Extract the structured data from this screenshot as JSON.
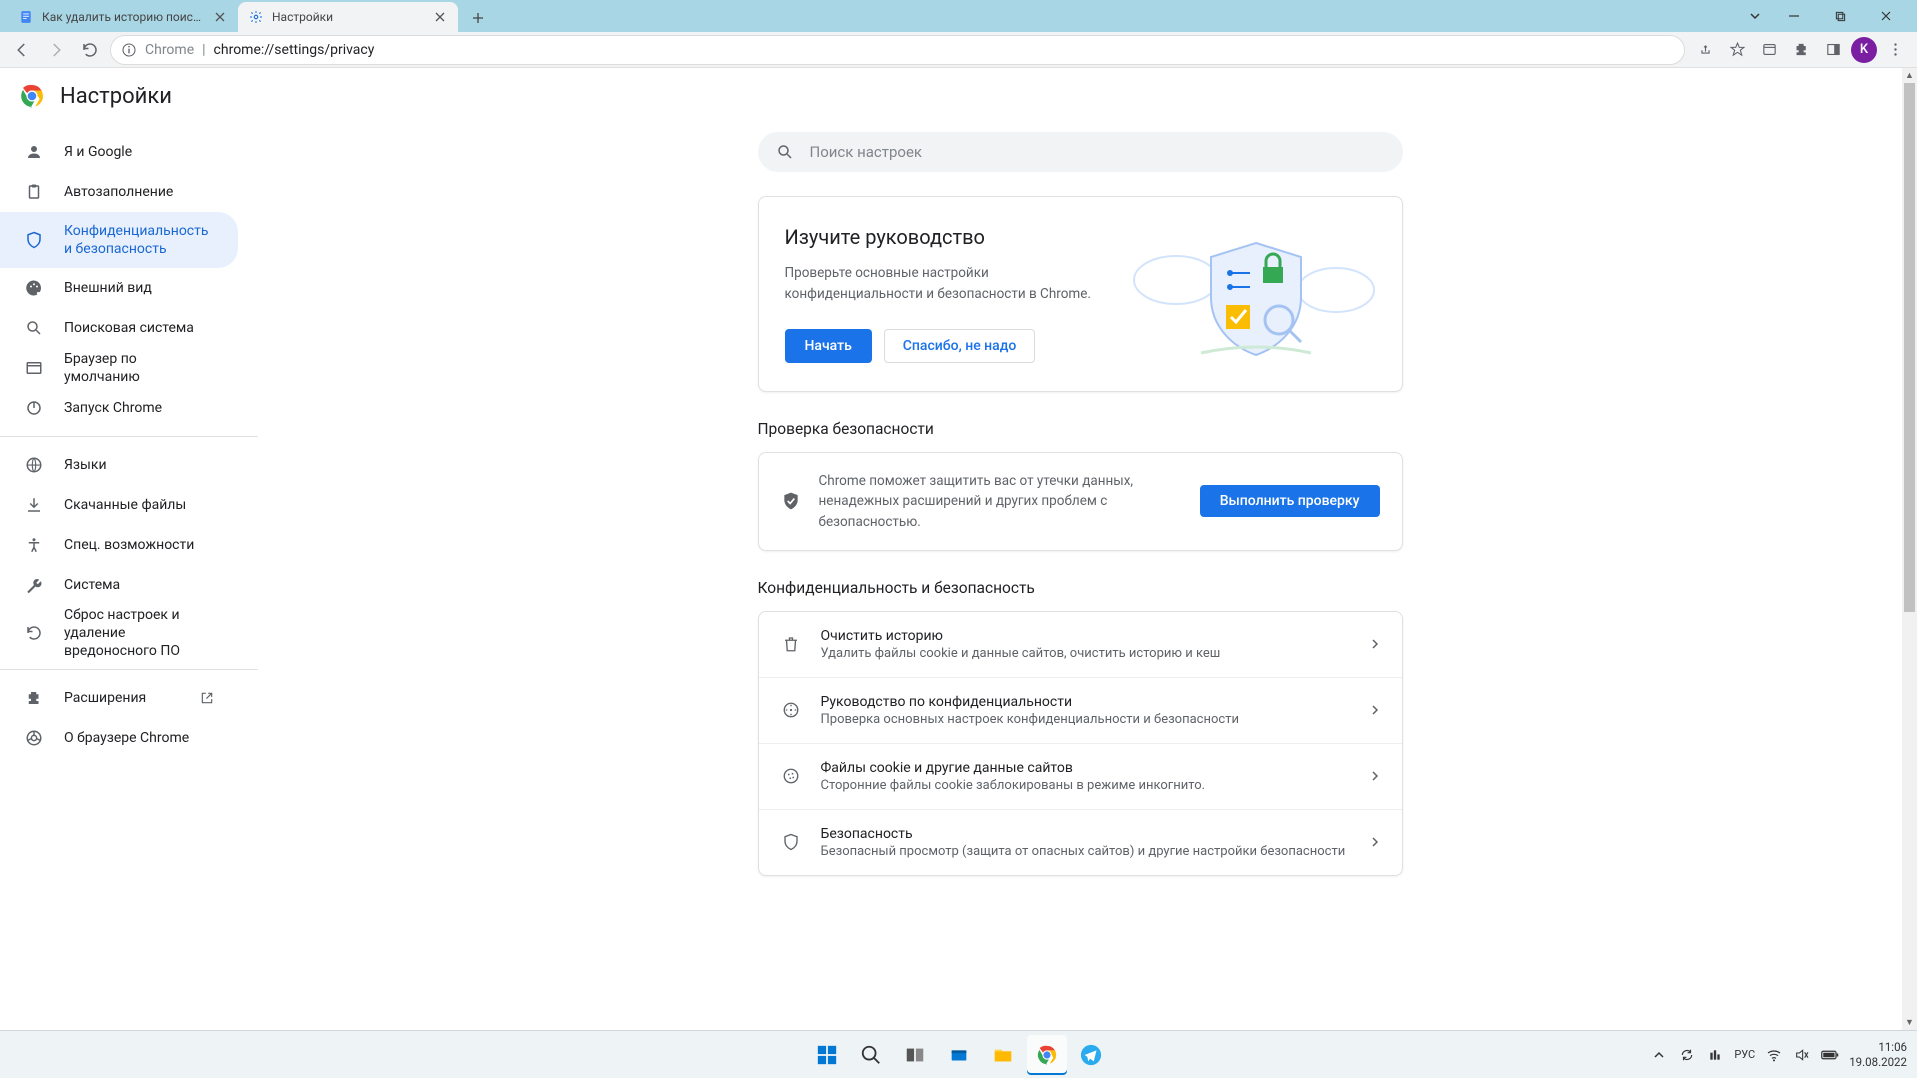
{
  "titlebar": {
    "tabs": [
      {
        "title": "Как удалить историю поиска G",
        "favicon": "docs"
      },
      {
        "title": "Настройки",
        "favicon": "gear"
      }
    ]
  },
  "toolbar": {
    "address_prefix": "Chrome",
    "address": "chrome://settings/privacy",
    "avatar_letter": "K"
  },
  "settings": {
    "app_title": "Настройки",
    "search_placeholder": "Поиск настроек"
  },
  "sidebar": {
    "items": [
      {
        "label": "Я и Google"
      },
      {
        "label": "Автозаполнение"
      },
      {
        "label": "Конфиденциальность и безопасность"
      },
      {
        "label": "Внешний вид"
      },
      {
        "label": "Поисковая система"
      },
      {
        "label": "Браузер по умолчанию"
      },
      {
        "label": "Запуск Chrome"
      }
    ],
    "items2": [
      {
        "label": "Языки"
      },
      {
        "label": "Скачанные файлы"
      },
      {
        "label": "Спец. возможности"
      },
      {
        "label": "Система"
      },
      {
        "label": "Сброс настроек и удаление вредоносного ПО"
      }
    ],
    "items3": [
      {
        "label": "Расширения"
      },
      {
        "label": "О браузере Chrome"
      }
    ]
  },
  "guide": {
    "title": "Изучите руководство",
    "desc": "Проверьте основные настройки конфиденциальности и безопасности в Chrome.",
    "start": "Начать",
    "dismiss": "Спасибо, не надо"
  },
  "safety_section": {
    "heading": "Проверка безопасности",
    "text": "Chrome поможет защитить вас от утечки данных, ненадежных расширений и других проблем с безопасностью.",
    "run": "Выполнить проверку"
  },
  "privacy_section": {
    "heading": "Конфиденциальность и безопасность",
    "rows": [
      {
        "title": "Очистить историю",
        "sub": "Удалить файлы cookie и данные сайтов, очистить историю и кеш"
      },
      {
        "title": "Руководство по конфиденциальности",
        "sub": "Проверка основных настроек конфиденциальности и безопасности"
      },
      {
        "title": "Файлы cookie и другие данные сайтов",
        "sub": "Сторонние файлы cookie заблокированы в режиме инкогнито."
      },
      {
        "title": "Безопасность",
        "sub": "Безопасный просмотр (защита от опасных сайтов) и другие настройки безопасности"
      }
    ]
  },
  "tray": {
    "lang": "РУС",
    "time": "11:06",
    "date": "19.08.2022"
  }
}
